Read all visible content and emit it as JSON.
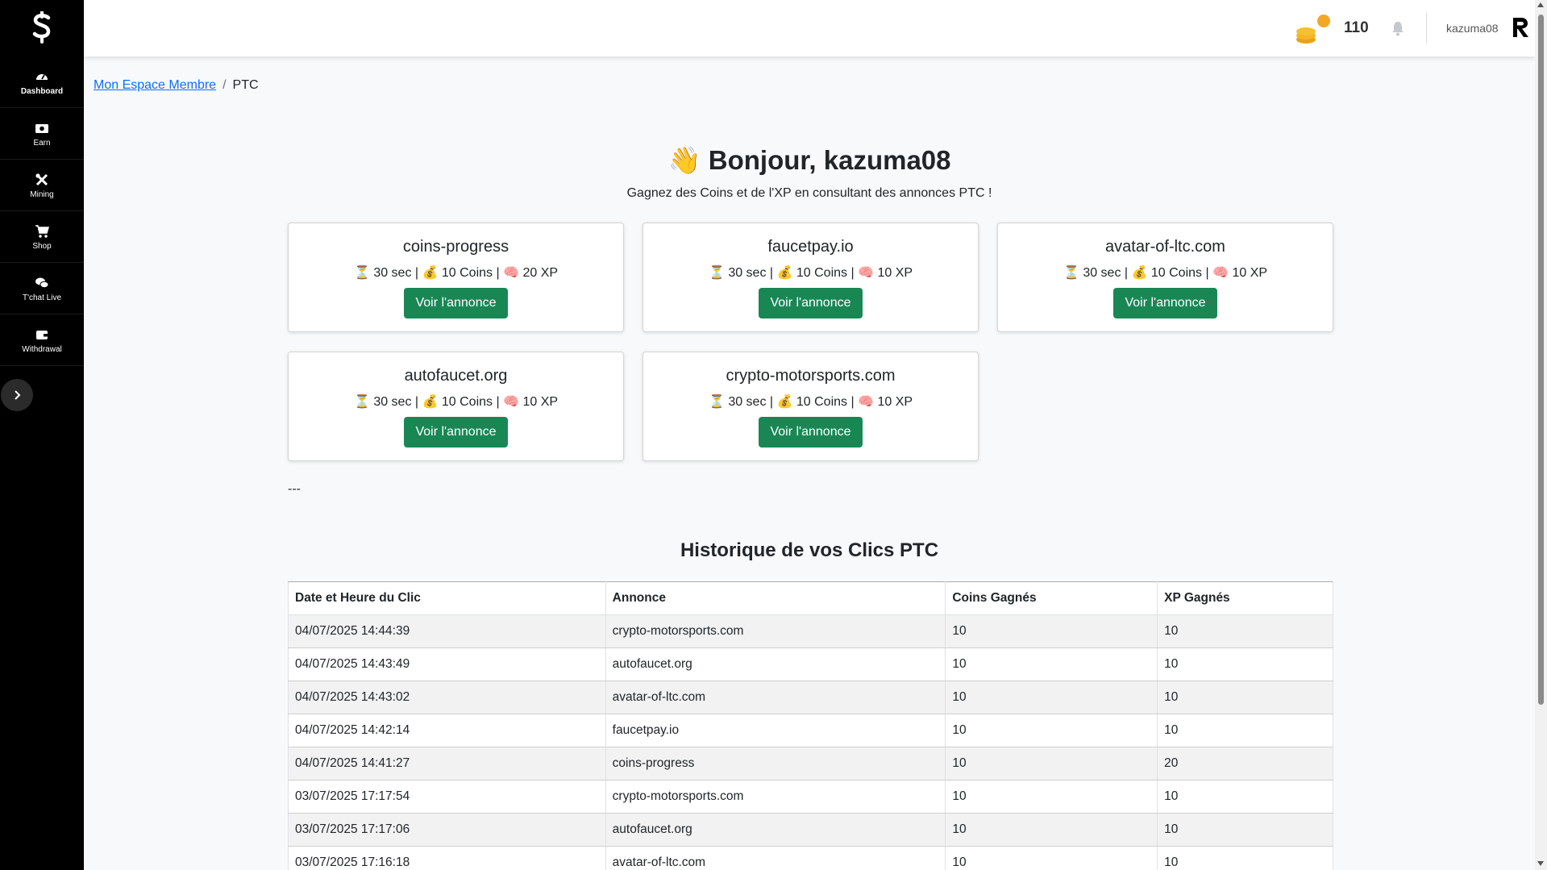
{
  "sidebar": {
    "items": [
      {
        "label": "Dashboard",
        "icon": "gauge-icon"
      },
      {
        "label": "Earn",
        "icon": "money-icon"
      },
      {
        "label": "Mining",
        "icon": "tools-icon"
      },
      {
        "label": "Shop",
        "icon": "cart-icon"
      },
      {
        "label": "T'chat Live",
        "icon": "chat-icon"
      },
      {
        "label": "Withdrawal",
        "icon": "wallet-icon"
      }
    ]
  },
  "topbar": {
    "coins": "110",
    "username": "kazuma08"
  },
  "breadcrumb": {
    "home": "Mon Espace Membre",
    "separator": "/",
    "current": "PTC"
  },
  "greeting": {
    "emoji": "👋",
    "prefix": "Bonjour,",
    "name": "kazuma08",
    "subtitle": "Gagnez des Coins et de l'XP en consultant des annonces PTC !"
  },
  "ads": [
    {
      "title": "coins-progress",
      "time": "30 sec",
      "coins": "10 Coins",
      "xp": "20 XP",
      "button": "Voir l'annonce"
    },
    {
      "title": "faucetpay.io",
      "time": "30 sec",
      "coins": "10 Coins",
      "xp": "10 XP",
      "button": "Voir l'annonce"
    },
    {
      "title": "avatar-of-ltc.com",
      "time": "30 sec",
      "coins": "10 Coins",
      "xp": "10 XP",
      "button": "Voir l'annonce"
    },
    {
      "title": "autofaucet.org",
      "time": "30 sec",
      "coins": "10 Coins",
      "xp": "10 XP",
      "button": "Voir l'annonce"
    },
    {
      "title": "crypto-motorsports.com",
      "time": "30 sec",
      "coins": "10 Coins",
      "xp": "10 XP",
      "button": "Voir l'annonce"
    }
  ],
  "separator_text": "---",
  "history": {
    "title": "Historique de vos Clics PTC",
    "headers": [
      "Date et Heure du Clic",
      "Annonce",
      "Coins Gagnés",
      "XP Gagnés"
    ],
    "rows": [
      [
        "04/07/2025 14:44:39",
        "crypto-motorsports.com",
        "10",
        "10"
      ],
      [
        "04/07/2025 14:43:49",
        "autofaucet.org",
        "10",
        "10"
      ],
      [
        "04/07/2025 14:43:02",
        "avatar-of-ltc.com",
        "10",
        "10"
      ],
      [
        "04/07/2025 14:42:14",
        "faucetpay.io",
        "10",
        "10"
      ],
      [
        "04/07/2025 14:41:27",
        "coins-progress",
        "10",
        "20"
      ],
      [
        "03/07/2025 17:17:54",
        "crypto-motorsports.com",
        "10",
        "10"
      ],
      [
        "03/07/2025 17:17:06",
        "autofaucet.org",
        "10",
        "10"
      ],
      [
        "03/07/2025 17:16:18",
        "avatar-of-ltc.com",
        "10",
        "10"
      ]
    ]
  }
}
